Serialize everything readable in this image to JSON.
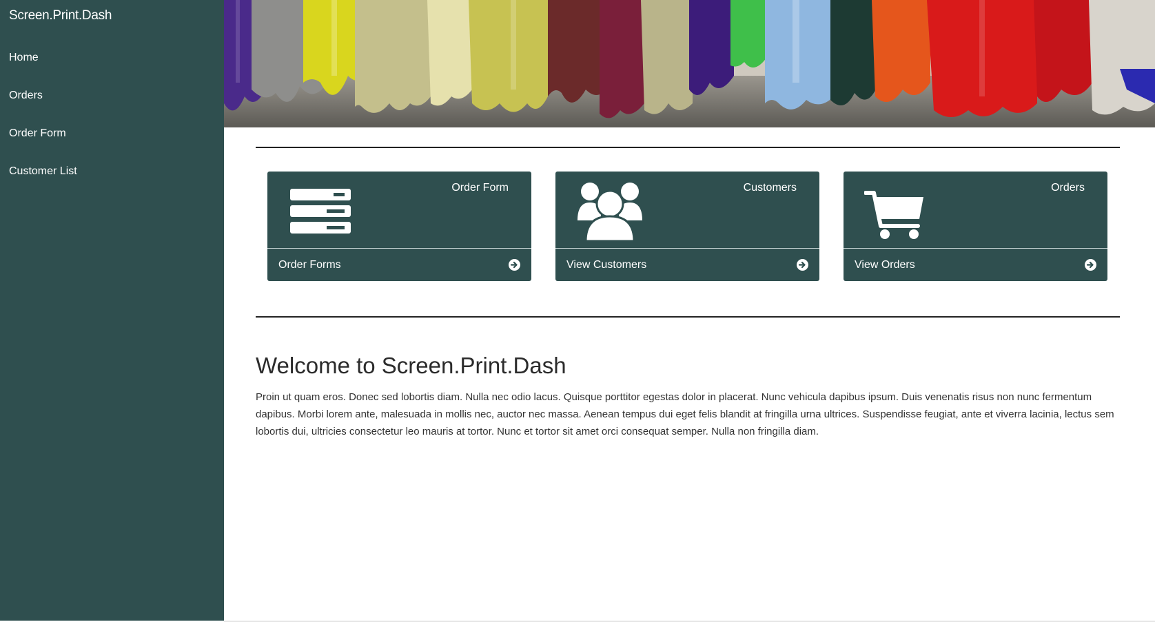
{
  "sidebar": {
    "brand": "Screen.Print.Dash",
    "items": [
      {
        "label": "Home"
      },
      {
        "label": "Orders"
      },
      {
        "label": "Order Form"
      },
      {
        "label": "Customer List"
      }
    ]
  },
  "cards": [
    {
      "title": "Order Form",
      "link": "Order Forms",
      "icon": "server-list-icon"
    },
    {
      "title": "Customers",
      "link": "View Customers",
      "icon": "users-icon"
    },
    {
      "title": "Orders",
      "link": "View Orders",
      "icon": "shopping-cart-icon"
    }
  ],
  "main": {
    "heading": "Welcome to Screen.Print.Dash",
    "paragraph": "Proin ut quam eros. Donec sed lobortis diam. Nulla nec odio lacus. Quisque porttitor egestas dolor in placerat. Nunc vehicula dapibus ipsum. Duis venenatis risus non nunc fermentum dapibus. Morbi lorem ante, malesuada in mollis nec, auctor nec massa. Aenean tempus dui eget felis blandit at fringilla urna ultrices. Suspendisse feugiat, ante et viverra lacinia, lectus sem lobortis dui, ultricies consectetur leo mauris at tortor. Nunc et tortor sit amet orci consequat semper. Nulla non fringilla diam."
  },
  "colors": {
    "sidebar": "#2f4f4f",
    "card": "#2f4f4f",
    "text_on_dark": "#ffffff"
  }
}
